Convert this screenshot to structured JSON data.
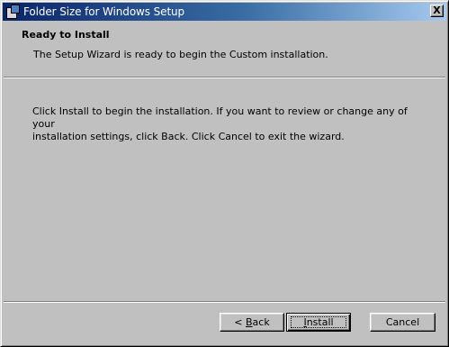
{
  "window": {
    "title": "Folder Size for Windows Setup",
    "close_label": "X"
  },
  "banner": {
    "heading": "Ready to Install",
    "description": "The Setup Wizard is ready to begin the Custom installation."
  },
  "main": {
    "instructions_line1": "Click Install to begin the installation.  If you want to review or change any of your",
    "instructions_line2": "installation settings, click Back.  Click Cancel to exit the wizard."
  },
  "buttons": {
    "back": {
      "prefix": "< ",
      "mnemonic": "B",
      "rest": "ack"
    },
    "install": {
      "mnemonic": "I",
      "rest": "nstall"
    },
    "cancel": "Cancel"
  }
}
